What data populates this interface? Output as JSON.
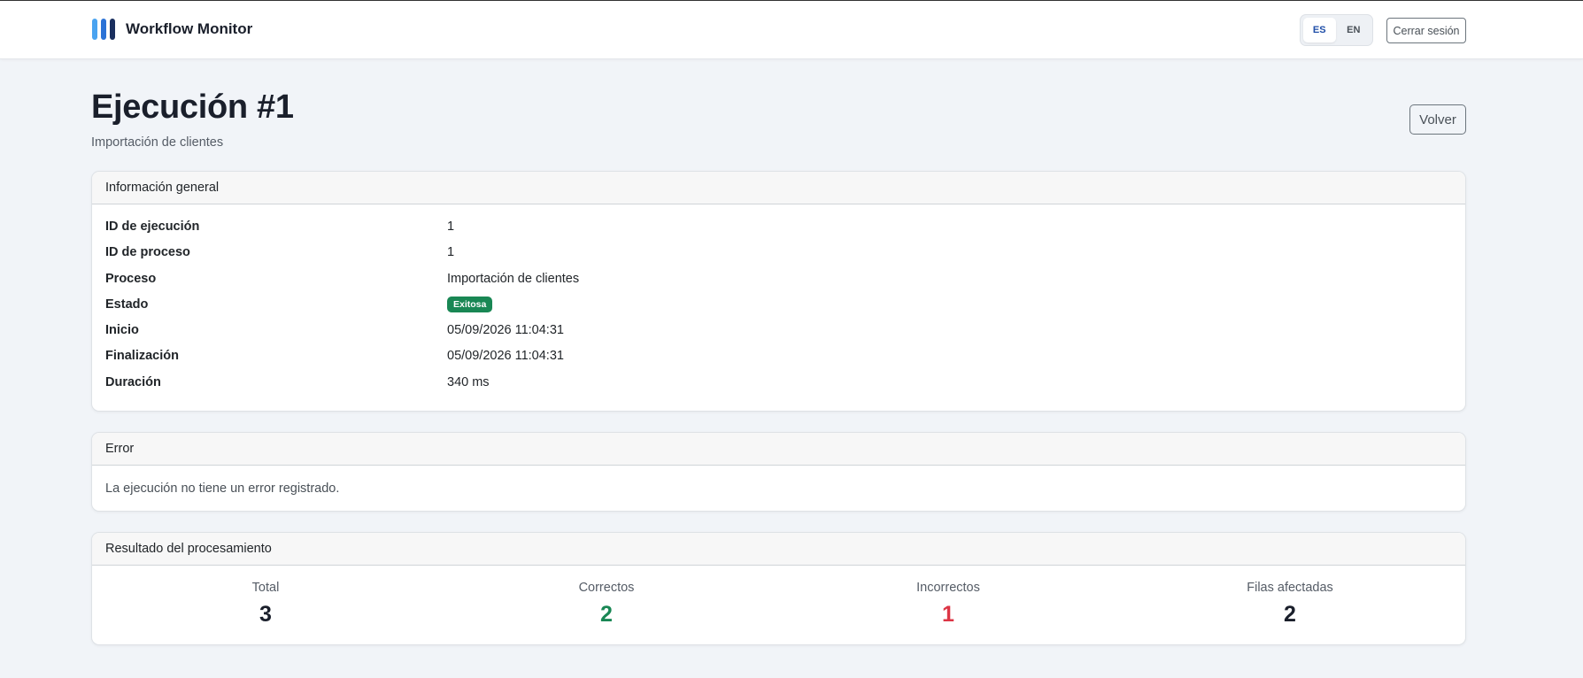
{
  "app": {
    "brand": "Workflow Monitor"
  },
  "header": {
    "languages": [
      "ES",
      "EN"
    ],
    "active_language": "ES",
    "logout_label": "Cerrar sesión"
  },
  "page": {
    "title": "Ejecución #1",
    "subtitle": "Importación de clientes",
    "back_label": "Volver"
  },
  "general_info": {
    "title": "Información general",
    "rows": [
      {
        "label": "ID de ejecución",
        "value": "1"
      },
      {
        "label": "ID de proceso",
        "value": "1"
      },
      {
        "label": "Proceso",
        "value": "Importación de clientes"
      },
      {
        "label": "Estado",
        "value": "Exitosa"
      },
      {
        "label": "Inicio",
        "value": "05/09/2026 11:04:31"
      },
      {
        "label": "Finalización",
        "value": "05/09/2026 11:04:31"
      },
      {
        "label": "Duración",
        "value": "340 ms"
      }
    ]
  },
  "error": {
    "title": "Error",
    "message": "La ejecución no tiene un error registrado."
  },
  "result": {
    "title": "Resultado del procesamiento",
    "stats": [
      {
        "label": "Total",
        "value": "3",
        "color": "#1a1f2b"
      },
      {
        "label": "Correctos",
        "value": "2",
        "color": "#198754"
      },
      {
        "label": "Incorrectos",
        "value": "1",
        "color": "#dc3545"
      },
      {
        "label": "Filas afectadas",
        "value": "2",
        "color": "#1a1f2b"
      }
    ]
  },
  "colors": {
    "accent": "#1f4ea8",
    "success": "#198754",
    "danger": "#dc3545",
    "logo_bars": [
      "#4aa3f0",
      "#2b72d6",
      "#1a2f5e"
    ]
  }
}
